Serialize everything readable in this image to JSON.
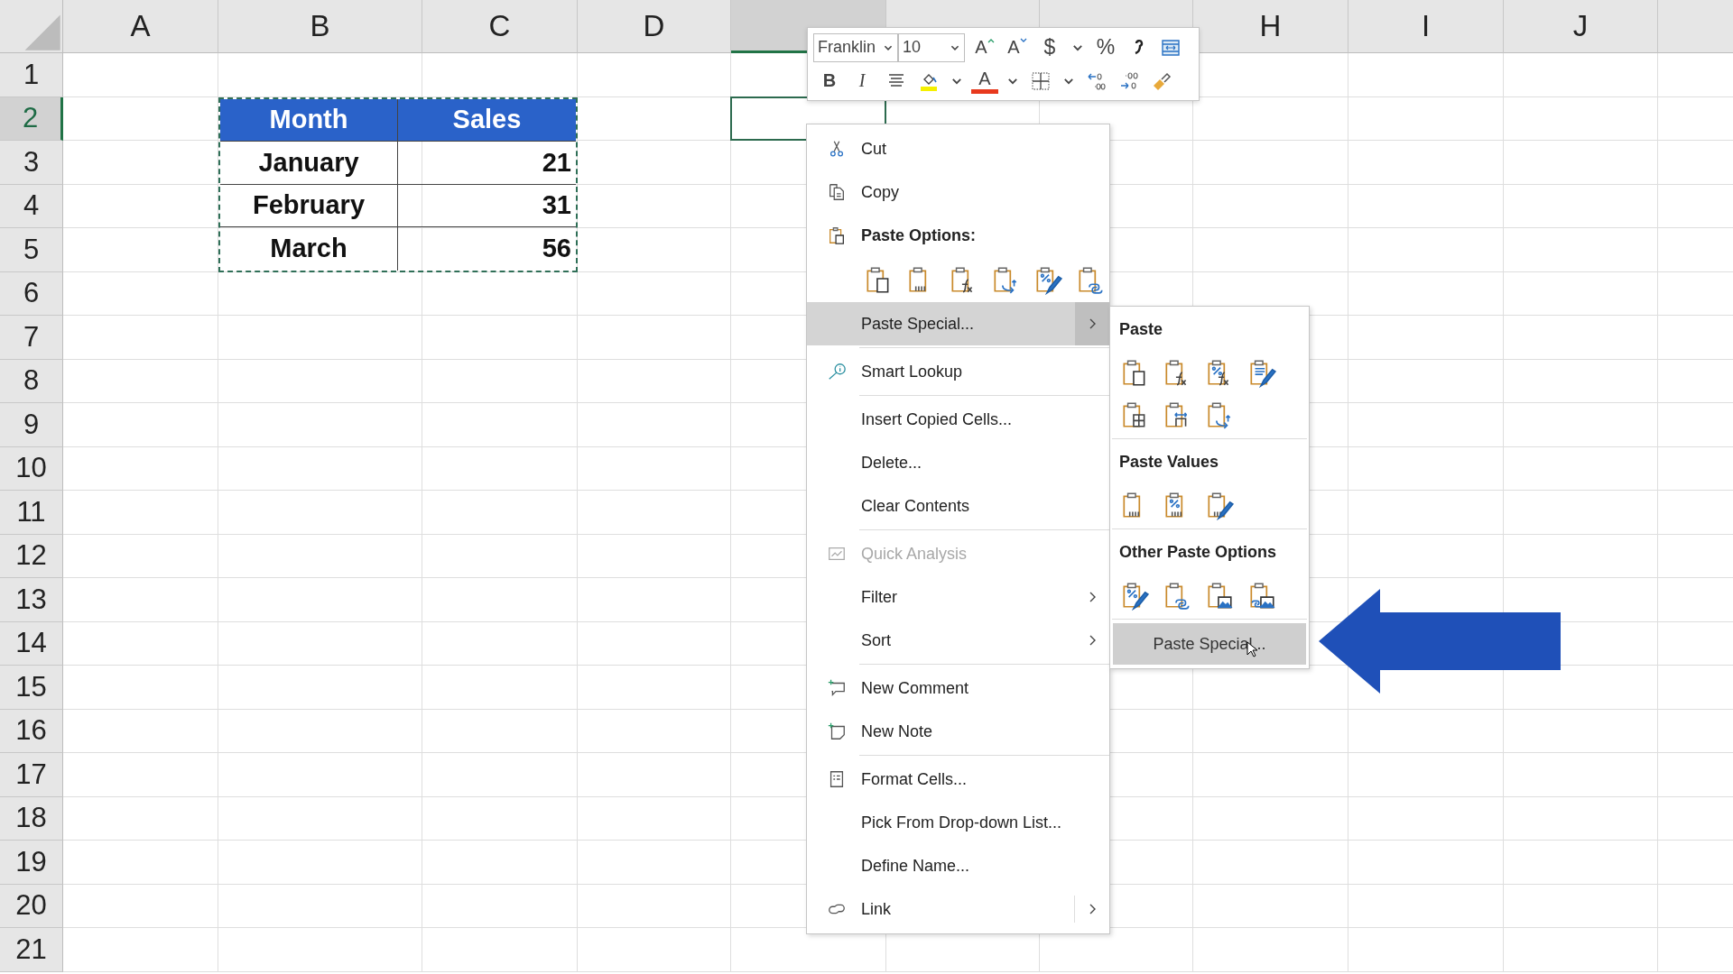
{
  "sheet": {
    "columns": [
      {
        "label": "A",
        "selected": false
      },
      {
        "label": "B",
        "selected": false
      },
      {
        "label": "C",
        "selected": false
      },
      {
        "label": "D",
        "selected": false
      },
      {
        "selected": true
      },
      {
        "selected": false
      },
      {
        "selected": false
      },
      {
        "label": "H",
        "selected": false
      },
      {
        "label": "I",
        "selected": false
      },
      {
        "label": "J",
        "selected": false
      },
      {
        "selected": false
      }
    ],
    "rows": [
      {
        "label": "1",
        "selected": false
      },
      {
        "label": "2",
        "selected": true
      },
      {
        "label": "3",
        "selected": false
      },
      {
        "label": "4",
        "selected": false
      },
      {
        "label": "5",
        "selected": false
      },
      {
        "label": "6",
        "selected": false
      },
      {
        "label": "7",
        "selected": false
      },
      {
        "label": "8",
        "selected": false
      },
      {
        "label": "9",
        "selected": false
      },
      {
        "label": "10",
        "selected": false
      },
      {
        "label": "11",
        "selected": false
      },
      {
        "label": "12",
        "selected": false
      },
      {
        "label": "13",
        "selected": false
      },
      {
        "label": "14",
        "selected": false
      },
      {
        "label": "15",
        "selected": false
      },
      {
        "label": "16",
        "selected": false
      },
      {
        "label": "17",
        "selected": false
      },
      {
        "label": "18",
        "selected": false
      },
      {
        "label": "19",
        "selected": false
      },
      {
        "label": "20",
        "selected": false
      },
      {
        "label": "21",
        "selected": false
      }
    ],
    "table": {
      "copied": true,
      "header": [
        "Month",
        "Sales"
      ],
      "rows": [
        [
          "January",
          "21"
        ],
        [
          "February",
          "31"
        ],
        [
          "March",
          "56"
        ]
      ]
    }
  },
  "mini_toolbar": {
    "font": "Franklin",
    "size": "10",
    "row1": [
      {
        "kind": "grow",
        "label": "A"
      },
      {
        "kind": "shrink",
        "label": "A"
      },
      {
        "kind": "text",
        "label": "$"
      },
      {
        "kind": "dropdown"
      },
      {
        "kind": "text",
        "label": "%"
      },
      {
        "kind": "comma"
      },
      {
        "kind": "merge"
      }
    ],
    "row2": [
      {
        "kind": "bold",
        "label": "B"
      },
      {
        "kind": "italic",
        "label": "I"
      },
      {
        "kind": "align"
      },
      {
        "kind": "fill"
      },
      {
        "kind": "dropdown"
      },
      {
        "kind": "font-color",
        "label": "A"
      },
      {
        "kind": "dropdown"
      },
      {
        "kind": "borders"
      },
      {
        "kind": "dropdown"
      },
      {
        "kind": "dec-decimal"
      },
      {
        "kind": "inc-decimal"
      },
      {
        "kind": "painter"
      }
    ]
  },
  "context_menu": {
    "groups": [
      [
        {
          "kind": "cut",
          "label": "Cut",
          "selected": false,
          "disabled": false,
          "submenu": false
        },
        {
          "kind": "copy",
          "label": "Copy",
          "selected": false,
          "disabled": false,
          "submenu": false
        },
        {
          "kind": "heading",
          "label": "Paste Options:"
        },
        {
          "kind": "options",
          "options": [
            {
              "kind": "paste"
            },
            {
              "kind": "values"
            },
            {
              "kind": "formulas"
            },
            {
              "kind": "transpose"
            },
            {
              "kind": "formatting"
            },
            {
              "kind": "link"
            }
          ]
        },
        {
          "kind": "plain",
          "label": "Paste Special...",
          "selected": true,
          "disabled": false,
          "submenu": true
        }
      ],
      [
        {
          "kind": "lookup",
          "label": "Smart Lookup",
          "selected": false,
          "disabled": false,
          "submenu": false
        }
      ],
      [
        {
          "kind": "plain",
          "label": "Insert Copied Cells...",
          "selected": false,
          "disabled": false,
          "submenu": false
        },
        {
          "kind": "plain",
          "label": "Delete...",
          "selected": false,
          "disabled": false,
          "submenu": false
        },
        {
          "kind": "plain",
          "label": "Clear Contents",
          "selected": false,
          "disabled": false,
          "submenu": false
        }
      ],
      [
        {
          "kind": "analysis",
          "label": "Quick Analysis",
          "selected": false,
          "disabled": true,
          "submenu": false
        },
        {
          "kind": "plain",
          "label": "Filter",
          "selected": false,
          "disabled": false,
          "submenu": true
        },
        {
          "kind": "plain",
          "label": "Sort",
          "selected": false,
          "disabled": false,
          "submenu": true
        }
      ],
      [
        {
          "kind": "comment",
          "label": "New Comment",
          "selected": false,
          "disabled": false,
          "submenu": false
        },
        {
          "kind": "note",
          "label": "New Note",
          "selected": false,
          "disabled": false,
          "submenu": false
        }
      ],
      [
        {
          "kind": "format",
          "label": "Format Cells...",
          "selected": false,
          "disabled": false,
          "submenu": false
        },
        {
          "kind": "plain",
          "label": "Pick From Drop-down List...",
          "selected": false,
          "disabled": false,
          "submenu": false
        },
        {
          "kind": "plain",
          "label": "Define Name...",
          "selected": false,
          "disabled": false,
          "submenu": false
        },
        {
          "kind": "link",
          "label": "Link",
          "selected": false,
          "disabled": false,
          "submenu": true
        }
      ]
    ]
  },
  "submenu": {
    "sections": [
      {
        "title": "Paste",
        "options": [
          {
            "kind": "paste"
          },
          {
            "kind": "formulas"
          },
          {
            "kind": "formulas-number"
          },
          {
            "kind": "source-formatting"
          },
          {
            "kind": "no-borders"
          },
          {
            "kind": "column-widths"
          },
          {
            "kind": "transpose"
          }
        ]
      },
      {
        "title": "Paste Values",
        "options": [
          {
            "kind": "values"
          },
          {
            "kind": "values-number"
          },
          {
            "kind": "values-formatting"
          }
        ]
      },
      {
        "title": "Other Paste Options",
        "options": [
          {
            "kind": "formatting"
          },
          {
            "kind": "link"
          },
          {
            "kind": "picture"
          },
          {
            "kind": "linked-picture"
          }
        ]
      }
    ],
    "footer": {
      "label": "Paste Special...",
      "selected": true
    }
  }
}
